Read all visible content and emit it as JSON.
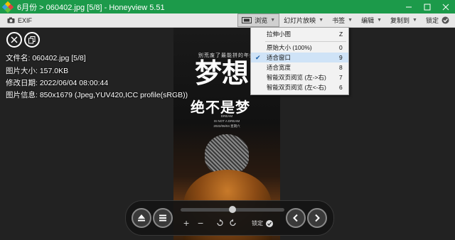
{
  "window": {
    "title": "6月份 > 060402.jpg [5/8] - Honeyview 5.51"
  },
  "toolbar": {
    "exif_label": "EXIF",
    "menus": [
      {
        "label": "浏览"
      },
      {
        "label": "幻灯片放映"
      },
      {
        "label": "书签"
      },
      {
        "label": "编辑"
      },
      {
        "label": "复制到"
      }
    ],
    "lock_label": "锁定"
  },
  "info": {
    "filename": "文件名: 060402.jpg [5/8]",
    "filesize": "图片大小: 157.0KB",
    "modified": "修改日期: 2022/06/04 08:00:44",
    "imageinfo": "图片信息: 850x1679 (Jpeg,YUV420,ICC profile(sRGB))"
  },
  "dropdown": {
    "items": [
      {
        "label": "拉伸小图",
        "key": "Z",
        "checked": false
      },
      {
        "label": "原始大小 (100%)",
        "key": "0",
        "checked": false
      },
      {
        "label": "适合窗口",
        "key": "9",
        "checked": true
      },
      {
        "label": "适合宽度",
        "key": "8",
        "checked": false
      },
      {
        "label": "智能双页阅览 (左->右)",
        "key": "7",
        "checked": false
      },
      {
        "label": "智能双页阅览 (左<-右)",
        "key": "6",
        "checked": false
      }
    ]
  },
  "poster": {
    "subtitle": "别荒废了最能拼的年纪",
    "title_line1": "梦想",
    "title_line2": "绝不是梦",
    "en_line1": "DREAM",
    "en_line2": "IS NOT A DREAM",
    "date": "2022/06/04 星期六"
  },
  "controls": {
    "lock_label": "锁定",
    "slider_position": 0.5,
    "plus": "+",
    "minus": "−"
  },
  "colors": {
    "titlebar": "#1c9a4a",
    "toolbar": "#e8e8e8",
    "viewer_bg": "#222222",
    "menu_highlight": "#cfe3f7"
  }
}
